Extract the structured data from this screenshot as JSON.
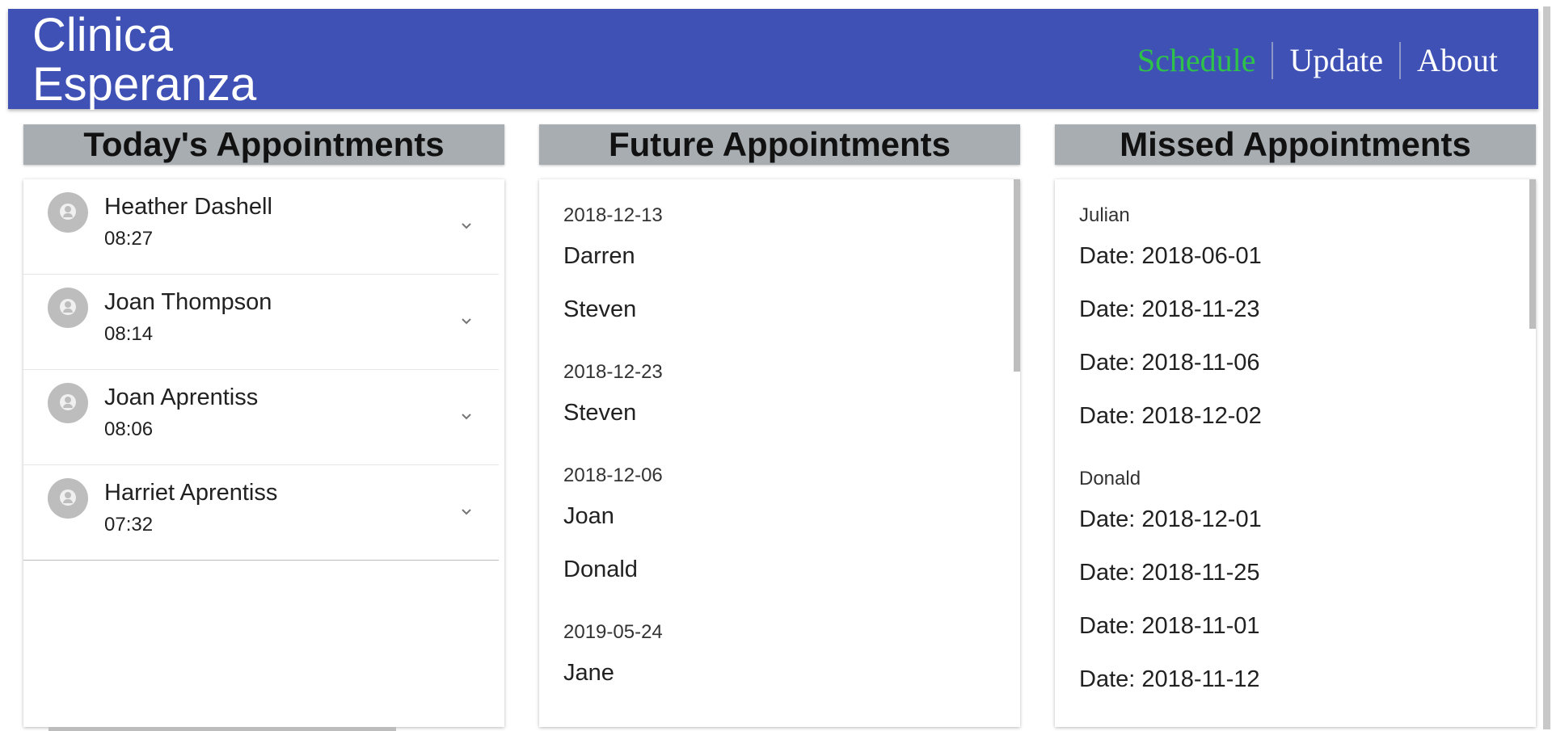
{
  "header": {
    "brand_line1": "Clinica",
    "brand_line2": "Esperanza",
    "nav": [
      {
        "label": "Schedule",
        "active": true
      },
      {
        "label": "Update",
        "active": false
      },
      {
        "label": "About",
        "active": false
      }
    ],
    "colors": {
      "bar": "#3f51b5",
      "active_nav": "#2ec24a"
    }
  },
  "today": {
    "title": "Today's Appointments",
    "items": [
      {
        "name": "Heather Dashell",
        "time": "08:27"
      },
      {
        "name": "Joan Thompson",
        "time": "08:14"
      },
      {
        "name": "Joan Aprentiss",
        "time": "08:06"
      },
      {
        "name": "Harriet Aprentiss",
        "time": "07:32"
      }
    ]
  },
  "future": {
    "title": "Future Appointments",
    "groups": [
      {
        "date": "2018-12-13",
        "names": [
          "Darren",
          "Steven"
        ]
      },
      {
        "date": "2018-12-23",
        "names": [
          "Steven"
        ]
      },
      {
        "date": "2018-12-06",
        "names": [
          "Joan",
          "Donald"
        ]
      },
      {
        "date": "2019-05-24",
        "names": [
          "Jane"
        ]
      }
    ]
  },
  "missed": {
    "title": "Missed Appointments",
    "groups": [
      {
        "name": "Julian",
        "dates": [
          "Date: 2018-06-01",
          "Date: 2018-11-23",
          "Date: 2018-11-06",
          "Date: 2018-12-02"
        ]
      },
      {
        "name": "Donald",
        "dates": [
          "Date: 2018-12-01",
          "Date: 2018-11-25",
          "Date: 2018-11-01",
          "Date: 2018-11-12"
        ]
      }
    ]
  }
}
